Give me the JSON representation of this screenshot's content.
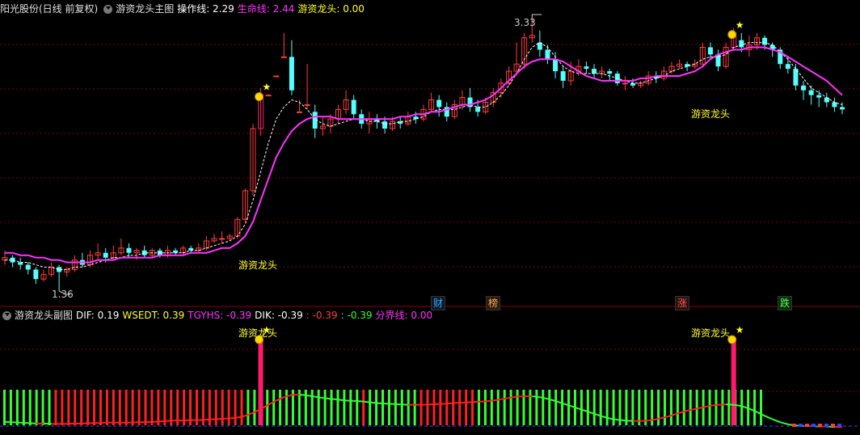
{
  "main_header": {
    "stock": "阳光股份(日线 前复权)",
    "indicator": "游资龙头主图",
    "op_line": "操作线: 2.29",
    "life_line": "生命线: 2.44",
    "dragon": "游资龙头: 0.00"
  },
  "sub_header": {
    "indicator": "游资龙头副图",
    "dif": "DIF: 0.19",
    "wsedt": "WSEDT: 0.39",
    "tgyhs": "TGYHS: -0.39",
    "dik": "DIK: -0.39",
    "v1": ": -0.39",
    "v2": ": -0.39",
    "boundary": "分界线: 0.00"
  },
  "annotations": {
    "high_price": "3.33",
    "low_price": "1.36",
    "signal_label": "游资龙头"
  },
  "markers": [
    "财",
    "榜",
    "涨",
    "跌"
  ],
  "colors": {
    "background": "#000000",
    "up": "#ff3c3c",
    "down": "#54ffff",
    "life_line": "#ff33ff",
    "op_line": "#ffffff",
    "signal_bar": "#ff1a6e",
    "green_bar": "#33ff33",
    "red_bar": "#ff2020",
    "grid": "#7a0000",
    "label_yellow": "#ffff33"
  },
  "chart_data": [
    {
      "type": "candlestick",
      "title": "游资龙头主图",
      "candles": [
        [
          2.33,
          2.34,
          2.37,
          2.31
        ],
        [
          2.34,
          2.32,
          2.35,
          2.3
        ],
        [
          2.32,
          2.31,
          2.34,
          2.29
        ],
        [
          2.31,
          2.29,
          2.32,
          2.27
        ],
        [
          2.29,
          2.25,
          2.3,
          2.23
        ],
        [
          2.25,
          2.27,
          2.29,
          2.24
        ],
        [
          2.27,
          2.3,
          2.32,
          2.26
        ],
        [
          2.3,
          2.28,
          2.31,
          2.2
        ],
        [
          2.28,
          2.29,
          2.3,
          2.26
        ],
        [
          2.29,
          2.33,
          2.35,
          2.28
        ],
        [
          2.33,
          2.31,
          2.36,
          2.3
        ],
        [
          2.31,
          2.35,
          2.37,
          2.3
        ],
        [
          2.35,
          2.36,
          2.4,
          2.33
        ],
        [
          2.36,
          2.34,
          2.38,
          2.32
        ],
        [
          2.34,
          2.36,
          2.39,
          2.33
        ],
        [
          2.36,
          2.38,
          2.42,
          2.35
        ],
        [
          2.38,
          2.36,
          2.4,
          2.34
        ],
        [
          2.36,
          2.37,
          2.38,
          2.33
        ],
        [
          2.37,
          2.35,
          2.39,
          2.34
        ],
        [
          2.35,
          2.37,
          2.38,
          2.34
        ],
        [
          2.37,
          2.35,
          2.38,
          2.34
        ],
        [
          2.35,
          2.37,
          2.39,
          2.34
        ],
        [
          2.37,
          2.36,
          2.38,
          2.35
        ],
        [
          2.36,
          2.38,
          2.39,
          2.35
        ],
        [
          2.38,
          2.37,
          2.39,
          2.36
        ],
        [
          2.37,
          2.38,
          2.4,
          2.36
        ],
        [
          2.38,
          2.41,
          2.43,
          2.37
        ],
        [
          2.41,
          2.42,
          2.44,
          2.4
        ],
        [
          2.42,
          2.42,
          2.45,
          2.4
        ],
        [
          2.42,
          2.43,
          2.44,
          2.41
        ],
        [
          2.43,
          2.5,
          2.51,
          2.42
        ],
        [
          2.5,
          2.62,
          2.63,
          2.49
        ],
        [
          2.62,
          2.88,
          2.9,
          2.6
        ],
        [
          2.88,
          3.02,
          3.05,
          2.85
        ],
        [
          3.02,
          3.02,
          3.02,
          3.02
        ],
        [
          3.1,
          3.1,
          3.1,
          3.1
        ],
        [
          3.18,
          3.18,
          3.28,
          3.18
        ],
        [
          3.18,
          3.04,
          3.25,
          3.02
        ],
        [
          2.95,
          2.95,
          3.0,
          2.95
        ],
        [
          2.98,
          2.98,
          3.15,
          2.96
        ],
        [
          2.95,
          2.88,
          2.98,
          2.84
        ],
        [
          2.88,
          2.89,
          2.93,
          2.85
        ],
        [
          2.89,
          2.92,
          2.94,
          2.86
        ],
        [
          2.92,
          2.96,
          2.98,
          2.9
        ],
        [
          2.96,
          3.0,
          3.04,
          2.94
        ],
        [
          3.0,
          2.94,
          3.02,
          2.92
        ],
        [
          2.94,
          2.9,
          2.96,
          2.88
        ],
        [
          2.9,
          2.92,
          2.95,
          2.86
        ],
        [
          2.92,
          2.91,
          2.94,
          2.88
        ],
        [
          2.91,
          2.88,
          2.93,
          2.86
        ],
        [
          2.88,
          2.91,
          2.93,
          2.87
        ],
        [
          2.91,
          2.9,
          2.93,
          2.88
        ],
        [
          2.9,
          2.93,
          2.95,
          2.89
        ],
        [
          2.93,
          2.92,
          2.95,
          2.9
        ],
        [
          2.92,
          2.96,
          2.98,
          2.91
        ],
        [
          2.96,
          3.0,
          3.03,
          2.95
        ],
        [
          3.0,
          2.97,
          3.02,
          2.93
        ],
        [
          2.97,
          2.93,
          2.99,
          2.91
        ],
        [
          2.93,
          2.98,
          3.0,
          2.92
        ],
        [
          2.98,
          3.01,
          3.04,
          2.96
        ],
        [
          3.01,
          2.97,
          3.05,
          2.95
        ],
        [
          2.97,
          2.95,
          3.0,
          2.93
        ],
        [
          2.95,
          2.99,
          3.01,
          2.94
        ],
        [
          2.99,
          3.03,
          3.05,
          2.97
        ],
        [
          3.03,
          3.07,
          3.09,
          3.01
        ],
        [
          3.07,
          3.12,
          3.14,
          3.06
        ],
        [
          3.12,
          3.15,
          3.24,
          3.1
        ],
        [
          3.15,
          3.26,
          3.28,
          3.13
        ],
        [
          3.26,
          3.27,
          3.33,
          3.24
        ],
        [
          3.24,
          3.21,
          3.29,
          3.18
        ],
        [
          3.21,
          3.17,
          3.23,
          3.15
        ],
        [
          3.17,
          3.12,
          3.2,
          3.09
        ],
        [
          3.12,
          3.08,
          3.14,
          3.05
        ],
        [
          3.08,
          3.12,
          3.16,
          3.06
        ],
        [
          3.12,
          3.14,
          3.17,
          3.1
        ],
        [
          3.14,
          3.13,
          3.16,
          3.11
        ],
        [
          3.13,
          3.11,
          3.15,
          3.09
        ],
        [
          3.11,
          3.12,
          3.14,
          3.09
        ],
        [
          3.12,
          3.11,
          3.13,
          3.08
        ],
        [
          3.11,
          3.07,
          3.12,
          3.06
        ],
        [
          3.07,
          3.07,
          3.1,
          3.04
        ],
        [
          3.07,
          3.06,
          3.09,
          3.05
        ],
        [
          3.06,
          3.07,
          3.08,
          3.05
        ],
        [
          3.07,
          3.1,
          3.12,
          3.06
        ],
        [
          3.1,
          3.09,
          3.12,
          3.07
        ],
        [
          3.09,
          3.12,
          3.14,
          3.08
        ],
        [
          3.12,
          3.14,
          3.16,
          3.11
        ],
        [
          3.14,
          3.15,
          3.17,
          3.13
        ],
        [
          3.15,
          3.14,
          3.16,
          3.12
        ],
        [
          3.14,
          3.15,
          3.17,
          3.13
        ],
        [
          3.15,
          3.22,
          3.24,
          3.14
        ],
        [
          3.22,
          3.19,
          3.24,
          3.17
        ],
        [
          3.19,
          3.14,
          3.21,
          3.12
        ],
        [
          3.14,
          3.22,
          3.24,
          3.13
        ],
        [
          3.22,
          3.28,
          3.3,
          3.21
        ],
        [
          3.25,
          3.22,
          3.28,
          3.2
        ],
        [
          3.21,
          3.23,
          3.27,
          3.18
        ],
        [
          3.23,
          3.26,
          3.28,
          3.21
        ],
        [
          3.26,
          3.23,
          3.27,
          3.21
        ],
        [
          3.23,
          3.21,
          3.24,
          3.18
        ],
        [
          3.21,
          3.15,
          3.22,
          3.13
        ],
        [
          3.15,
          3.13,
          3.18,
          3.11
        ],
        [
          3.13,
          3.06,
          3.15,
          3.04
        ],
        [
          3.06,
          3.04,
          3.08,
          3.0
        ],
        [
          3.04,
          3.02,
          3.06,
          2.98
        ],
        [
          3.02,
          3.01,
          3.04,
          2.97
        ],
        [
          3.01,
          2.99,
          3.03,
          2.97
        ],
        [
          2.99,
          2.97,
          3.01,
          2.95
        ],
        [
          2.97,
          2.96,
          2.99,
          2.94
        ]
      ],
      "op_line": [
        2.33,
        2.33,
        2.32,
        2.32,
        2.31,
        2.3,
        2.3,
        2.29,
        2.29,
        2.3,
        2.3,
        2.31,
        2.32,
        2.33,
        2.34,
        2.34,
        2.35,
        2.35,
        2.36,
        2.36,
        2.36,
        2.36,
        2.36,
        2.36,
        2.37,
        2.37,
        2.38,
        2.39,
        2.4,
        2.41,
        2.43,
        2.48,
        2.58,
        2.7,
        2.82,
        2.92,
        2.97,
        3.0,
        2.99,
        2.96,
        2.92,
        2.9,
        2.89,
        2.9,
        2.91,
        2.92,
        2.92,
        2.91,
        2.91,
        2.9,
        2.9,
        2.91,
        2.91,
        2.92,
        2.93,
        2.95,
        2.96,
        2.96,
        2.96,
        2.97,
        2.98,
        2.97,
        2.97,
        2.99,
        3.02,
        3.06,
        3.11,
        3.17,
        3.22,
        3.24,
        3.22,
        3.18,
        3.14,
        3.12,
        3.11,
        3.11,
        3.11,
        3.11,
        3.1,
        3.09,
        3.08,
        3.07,
        3.07,
        3.08,
        3.09,
        3.1,
        3.12,
        3.13,
        3.14,
        3.15,
        3.17,
        3.18,
        3.18,
        3.19,
        3.22,
        3.23,
        3.24,
        3.24,
        3.24,
        3.23,
        3.2,
        3.17,
        3.13,
        3.09,
        3.05,
        3.03,
        3.01,
        2.99,
        2.98
      ],
      "life_line": [
        2.36,
        2.36,
        2.35,
        2.35,
        2.34,
        2.34,
        2.33,
        2.33,
        2.32,
        2.32,
        2.32,
        2.32,
        2.33,
        2.33,
        2.33,
        2.34,
        2.34,
        2.34,
        2.34,
        2.34,
        2.35,
        2.35,
        2.35,
        2.35,
        2.36,
        2.36,
        2.36,
        2.37,
        2.38,
        2.38,
        2.4,
        2.43,
        2.49,
        2.58,
        2.67,
        2.76,
        2.82,
        2.87,
        2.9,
        2.92,
        2.93,
        2.93,
        2.93,
        2.92,
        2.92,
        2.92,
        2.92,
        2.92,
        2.92,
        2.92,
        2.92,
        2.93,
        2.93,
        2.94,
        2.94,
        2.95,
        2.95,
        2.96,
        2.97,
        2.98,
        2.98,
        2.99,
        3.0,
        3.02,
        3.05,
        3.08,
        3.11,
        3.14,
        3.16,
        3.17,
        3.17,
        3.17,
        3.16,
        3.14,
        3.12,
        3.1,
        3.09,
        3.08,
        3.08,
        3.08,
        3.08,
        3.08,
        3.09,
        3.09,
        3.1,
        3.1,
        3.1,
        3.1,
        3.11,
        3.12,
        3.14,
        3.17,
        3.19,
        3.2,
        3.21,
        3.21,
        3.22,
        3.22,
        3.22,
        3.21,
        3.2,
        3.18,
        3.16,
        3.14,
        3.12,
        3.1,
        3.08,
        3.05,
        3.02
      ],
      "signals": [
        33,
        94
      ],
      "high": {
        "index": 68,
        "value": 3.33
      },
      "low": {
        "index": 7,
        "value": 1.36
      }
    },
    {
      "type": "bar",
      "title": "游资龙头副图",
      "bar_colors": [
        "g",
        "g",
        "g",
        "g",
        "g",
        "g",
        "g",
        "g",
        "r",
        "r",
        "r",
        "r",
        "r",
        "r",
        "r",
        "r",
        "r",
        "r",
        "r",
        "r",
        "r",
        "r",
        "r",
        "r",
        "r",
        "r",
        "r",
        "r",
        "r",
        "r",
        "r",
        "r",
        "r",
        "r",
        "r",
        "r",
        "r",
        "r",
        "g",
        "g",
        "g",
        "g",
        "g",
        "g",
        "g",
        "g",
        "g",
        "g",
        "g",
        "g",
        "g",
        "g",
        "g",
        "g",
        "g",
        "g",
        "r",
        "g",
        "g",
        "g",
        "g",
        "g",
        "g",
        "g",
        "g",
        "r",
        "r",
        "r",
        "r",
        "r",
        "r",
        "r",
        "r",
        "r",
        "g",
        "g",
        "g",
        "g",
        "g",
        "g",
        "g",
        "g",
        "g",
        "g",
        "g",
        "g",
        "g",
        "g",
        "g",
        "g",
        "g",
        "g",
        "g",
        "g",
        "g",
        "g",
        "g",
        "g",
        "g",
        "g",
        "g",
        "g",
        "g",
        "g",
        "g",
        "g",
        "g",
        "g",
        "g",
        "g",
        "g",
        "g",
        "g",
        "g",
        "g",
        "g",
        "g",
        "g",
        "g"
      ],
      "wave": [
        0.12,
        0.11,
        0.1,
        0.09,
        0.08,
        0.08,
        0.07,
        0.07,
        0.07,
        0.08,
        0.08,
        0.09,
        0.09,
        0.1,
        0.1,
        0.1,
        0.1,
        0.11,
        0.11,
        0.12,
        0.13,
        0.14,
        0.15,
        0.15,
        0.16,
        0.16,
        0.17,
        0.18,
        0.19,
        0.2,
        0.22,
        0.26,
        0.33,
        0.42,
        0.52,
        0.62,
        0.7,
        0.75,
        0.76,
        0.74,
        0.71,
        0.68,
        0.66,
        0.64,
        0.62,
        0.61,
        0.6,
        0.58,
        0.56,
        0.55,
        0.54,
        0.53,
        0.52,
        0.52,
        0.52,
        0.53,
        0.54,
        0.55,
        0.56,
        0.57,
        0.58,
        0.59,
        0.6,
        0.62,
        0.65,
        0.68,
        0.71,
        0.72,
        0.72,
        0.7,
        0.66,
        0.61,
        0.55,
        0.49,
        0.43,
        0.37,
        0.31,
        0.25,
        0.2,
        0.17,
        0.15,
        0.14,
        0.14,
        0.15,
        0.18,
        0.22,
        0.27,
        0.33,
        0.38,
        0.42,
        0.46,
        0.5,
        0.52,
        0.53,
        0.52,
        0.49,
        0.43,
        0.35,
        0.26,
        0.18,
        0.11,
        0.06,
        0.03,
        0.02,
        0.02,
        0.01,
        0.01,
        0.0,
        0.0
      ],
      "signals": [
        33,
        94
      ]
    }
  ]
}
